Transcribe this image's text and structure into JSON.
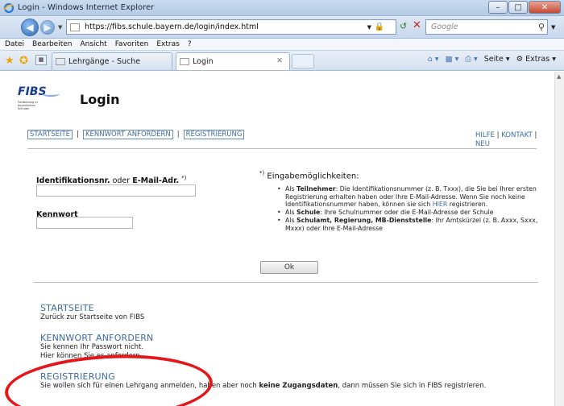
{
  "window": {
    "title": "Login - Windows Internet Explorer",
    "url": "https://fibs.schule.bayern.de/login/index.html",
    "search_placeholder": "Google"
  },
  "menu": [
    "Datei",
    "Bearbeiten",
    "Ansicht",
    "Favoriten",
    "Extras",
    "?"
  ],
  "tabs": [
    {
      "label": "Lehrgänge - Suche"
    },
    {
      "label": "Login"
    }
  ],
  "commandbar": {
    "page": "Seite",
    "tools": "Extras"
  },
  "page": {
    "logo_text": "FIBS",
    "logo_subtitle": "Fortbildung in bayerischen Schulen",
    "title": "Login",
    "nav": [
      "STARTSEITE",
      "KENNWORT ANFORDERN",
      "REGISTRIERUNG"
    ],
    "help": "HILFE",
    "contact": "KONTAKT",
    "new": "NEU",
    "form": {
      "id_label_bold": "Identifikationsnr.",
      "id_label_mid": " oder ",
      "id_label_bold2": "E-Mail-Adr.",
      "id_label_mark": "*)",
      "password_label": "Kennwort",
      "submit": "Ok"
    },
    "hints": {
      "title_mark": "*)",
      "title": "Eingabemöglichkeiten:",
      "items": [
        {
          "pre": "Als ",
          "bold": "Teilnehmer",
          "text": ": Die Identifikationsnummer (z. B. Txxx), die Sie bei Ihrer ersten Registrierung erhalten haben oder Ihre E-Mail-Adresse. Wenn Sie noch keine Identifikationsnummer haben, können sie sich ",
          "link": "HIER",
          "post": " registrieren."
        },
        {
          "pre": "Als ",
          "bold": "Schule",
          "text": ": Ihre Schulnummer oder die E-Mail-Adresse der Schule"
        },
        {
          "pre": "Als ",
          "bold": "Schulamt, Regierung, MB-Dienststelle",
          "text": ": Ihr Amtskürzel (z. B. Axxx, Sxxx, Mxxx) oder Ihre E-Mail-Adresse"
        }
      ]
    },
    "sections": [
      {
        "heading": "STARTSEITE",
        "desc": "Zurück zur Startseite von FIBS"
      },
      {
        "heading": "KENNWORT ANFORDERN",
        "desc1": "Sie kennen Ihr Passwort nicht.",
        "desc2": "Hier können Sie es anfordern."
      },
      {
        "heading": "REGISTRIERUNG",
        "desc_pre": "Sie wollen sich für einen Lehrgang anmelden, haben aber noch ",
        "desc_bold": "keine Zugangsdaten",
        "desc_post": ", dann müssen Sie sich in FIBS registrieren."
      }
    ]
  },
  "annotation_color": "#e3161b"
}
